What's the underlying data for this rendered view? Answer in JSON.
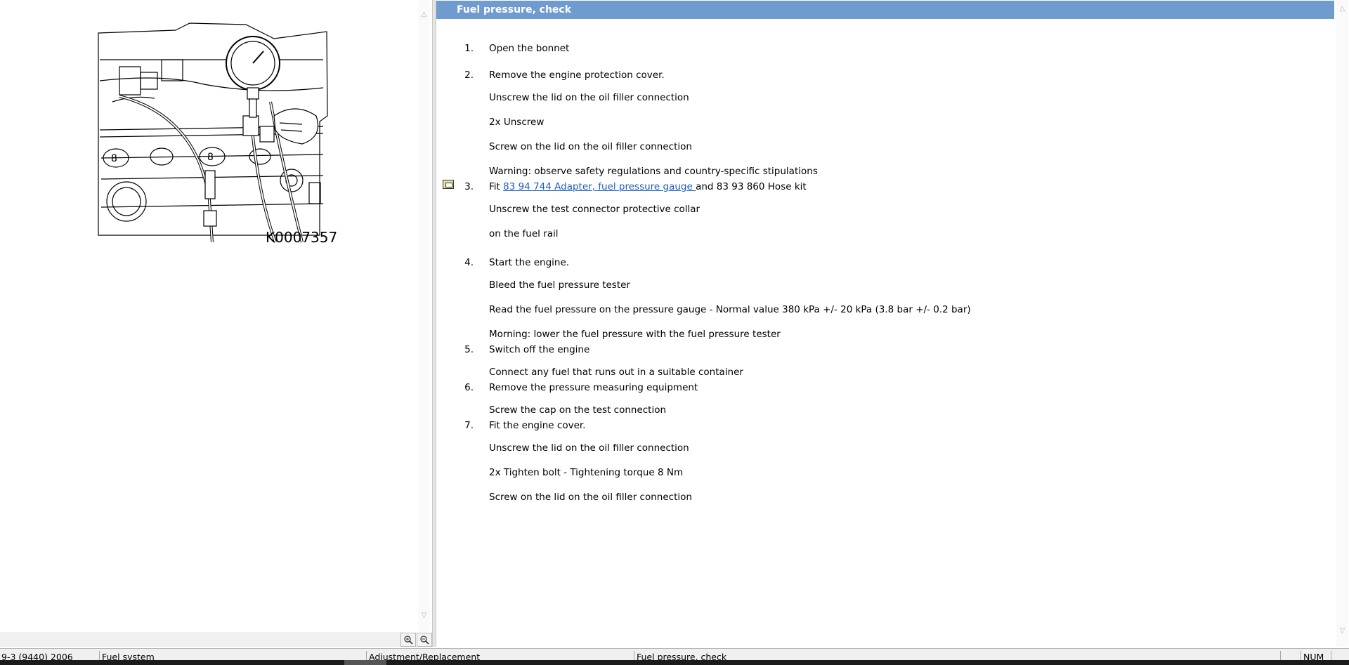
{
  "figure": {
    "label": "K0007357"
  },
  "document": {
    "title": "Fuel pressure, check",
    "steps": [
      {
        "num": "1.",
        "text": "Open the bonnet"
      },
      {
        "num": "2.",
        "text": "Remove the engine protection cover."
      },
      {
        "num": "3.",
        "prefix": "Fit ",
        "link": "83 94 744 Adapter, fuel pressure gauge ",
        "suffix": "and 83 93 860 Hose kit"
      },
      {
        "num": "4.",
        "text": "Start the engine."
      },
      {
        "num": "5.",
        "text": "Switch off the engine"
      },
      {
        "num": "6.",
        "text": "Remove the pressure measuring equipment"
      },
      {
        "num": "7.",
        "text": "Fit the engine cover."
      }
    ],
    "subs": [
      "Unscrew the lid on the oil filler connection",
      "2x Unscrew",
      "Screw on the lid on the oil filler connection",
      "Warning: observe safety regulations and country-specific stipulations",
      "Unscrew the test connector protective collar",
      "on the fuel rail",
      "Bleed the fuel pressure tester",
      "Read the fuel pressure on the pressure gauge - Normal value 380 kPa +/- 20 kPa (3.8 bar +/- 0.2 bar)",
      "Morning: lower the fuel pressure with the fuel pressure tester",
      "Connect any fuel that runs out in a suitable container",
      "Screw the cap on the test connection",
      "Unscrew the lid on the oil filler connection",
      "2x Tighten bolt - Tightening torque 8 Nm",
      "Screw on the lid on the oil filler connection"
    ]
  },
  "status_bar": {
    "model": "9-3 (9440) 2006",
    "system": "Fuel system",
    "operation": "Adjustment/Replacement",
    "procedure": "Fuel pressure, check",
    "num": "NUM"
  },
  "icons": [
    "zoom-in-icon",
    "zoom-out-icon",
    "scroll-up-icon",
    "scroll-down-icon",
    "tool-icon"
  ]
}
